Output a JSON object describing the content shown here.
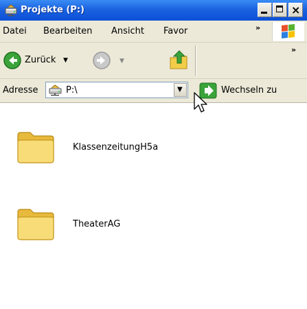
{
  "window": {
    "title": "Projekte (P:)",
    "buttons": {
      "minimize": "_",
      "maximize": "□",
      "close": "×"
    }
  },
  "menubar": {
    "items": [
      "Datei",
      "Bearbeiten",
      "Ansicht",
      "Favor"
    ],
    "overflow": "»"
  },
  "toolbar": {
    "back_label": "Zurück",
    "overflow": "»"
  },
  "addressbar": {
    "label": "Adresse",
    "value": "P:\\",
    "go_label": "Wechseln zu"
  },
  "files": [
    {
      "name": "KlassenzeitungH5a",
      "type": "folder"
    },
    {
      "name": "TheaterAG",
      "type": "folder"
    }
  ],
  "colors": {
    "titlebar": "#0b4fd8",
    "chrome": "#ece9d8",
    "go_green": "#2e9a2a"
  }
}
